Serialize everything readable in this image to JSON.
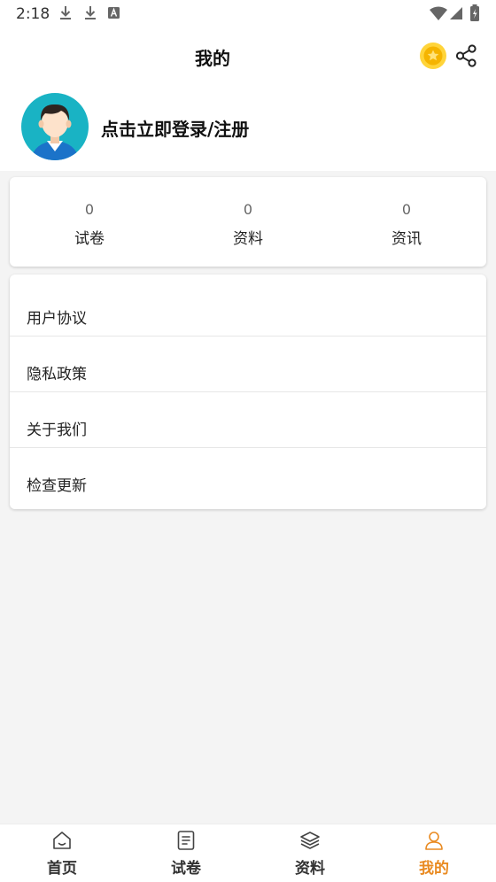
{
  "status_bar": {
    "time": "2:18",
    "icons": [
      "download-icon",
      "download-icon",
      "font-icon",
      "wifi-icon",
      "signal-icon",
      "battery-icon"
    ]
  },
  "header": {
    "title": "我的",
    "coin_icon": "coin-icon",
    "share_icon": "share-icon"
  },
  "profile": {
    "avatar_icon": "avatar-icon",
    "login_text": "点击立即登录/注册"
  },
  "stats": [
    {
      "count": "0",
      "label": "试卷"
    },
    {
      "count": "0",
      "label": "资料"
    },
    {
      "count": "0",
      "label": "资讯"
    }
  ],
  "menu": [
    {
      "label": "用户协议"
    },
    {
      "label": "隐私政策"
    },
    {
      "label": "关于我们"
    },
    {
      "label": "检查更新"
    }
  ],
  "tabbar": {
    "active_index": 3,
    "active_color": "#e98a21",
    "tabs": [
      {
        "label": "首页",
        "icon": "home-icon"
      },
      {
        "label": "试卷",
        "icon": "document-icon"
      },
      {
        "label": "资料",
        "icon": "layers-icon"
      },
      {
        "label": "我的",
        "icon": "user-icon"
      }
    ]
  }
}
